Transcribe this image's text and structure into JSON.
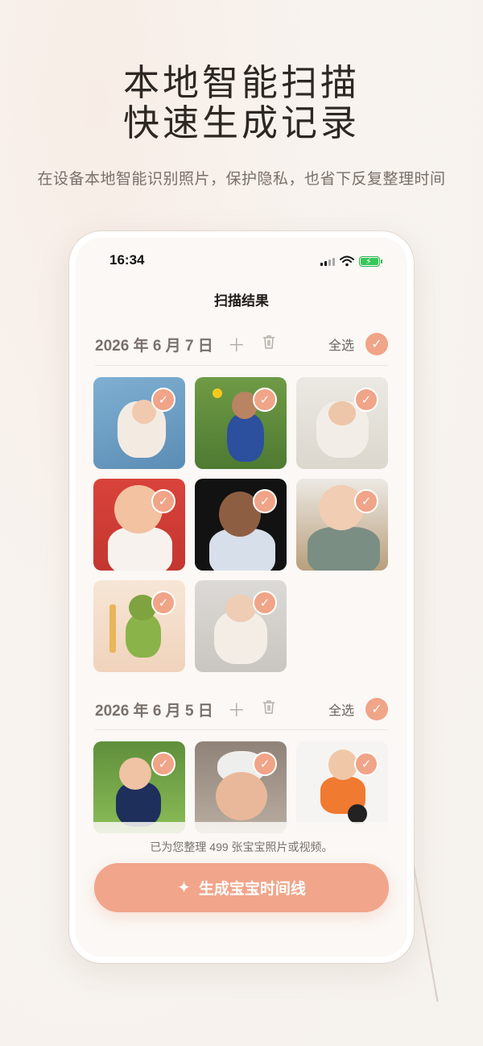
{
  "hero": {
    "title_line1": "本地智能扫描",
    "title_line2": "快速生成记录",
    "subtitle": "在设备本地智能识别照片，保护隐私，也省下反复整理时间"
  },
  "status_bar": {
    "time": "16:34",
    "icons": [
      "signal-icon",
      "wifi-icon",
      "battery-charging-icon"
    ]
  },
  "nav": {
    "title": "扫描结果"
  },
  "sections": [
    {
      "date": "2026 年 6 月 7 日",
      "select_all_label": "全选",
      "add_icon": "plus-icon",
      "delete_icon": "trash-icon",
      "photos": [
        {
          "icon": "baby-photo",
          "selected": true,
          "bg": "#6e9fc4"
        },
        {
          "icon": "baby-photo",
          "selected": true,
          "bg": "#5f8a3e"
        },
        {
          "icon": "baby-photo",
          "selected": true,
          "bg": "#e8e6df"
        },
        {
          "icon": "baby-photo",
          "selected": true,
          "bg": "#c93b33"
        },
        {
          "icon": "baby-photo",
          "selected": true,
          "bg": "#151515"
        },
        {
          "icon": "baby-photo",
          "selected": true,
          "bg": "#b7a58e"
        },
        {
          "icon": "baby-photo",
          "selected": true,
          "bg": "#f3dcc6"
        },
        {
          "icon": "baby-photo",
          "selected": true,
          "bg": "#d9d6d2"
        }
      ]
    },
    {
      "date": "2026 年 6 月 5 日",
      "select_all_label": "全选",
      "add_icon": "plus-icon",
      "delete_icon": "trash-icon",
      "photos": [
        {
          "icon": "baby-photo",
          "selected": true,
          "bg": "#7fae55"
        },
        {
          "icon": "baby-photo",
          "selected": true,
          "bg": "#a89c92"
        },
        {
          "icon": "baby-photo",
          "selected": true,
          "bg": "#f4f1ee"
        }
      ]
    }
  ],
  "footer": {
    "summary": "已为您整理 499 张宝宝照片或视频。",
    "generate_button": "生成宝宝时间线",
    "generate_icon": "sparkle-icon"
  },
  "colors": {
    "accent": "#f1a58a",
    "check": "#f0a488",
    "background": "#f6f2ee"
  }
}
